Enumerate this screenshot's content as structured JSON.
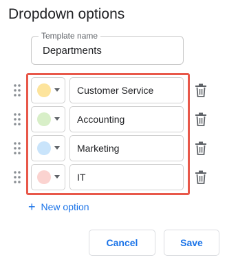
{
  "dialog": {
    "title": "Dropdown options"
  },
  "template": {
    "label": "Template name",
    "value": "Departments"
  },
  "options": [
    {
      "text": "Customer Service",
      "color": "#fde49c",
      "color_icon": "color-swatch",
      "delete_icon": "trash-icon",
      "drag_icon": "drag-handle-icon"
    },
    {
      "text": "Accounting",
      "color": "#d8efc8",
      "color_icon": "color-swatch",
      "delete_icon": "trash-icon",
      "drag_icon": "drag-handle-icon"
    },
    {
      "text": "Marketing",
      "color": "#c9e4fb",
      "color_icon": "color-swatch",
      "delete_icon": "trash-icon",
      "drag_icon": "drag-handle-icon"
    },
    {
      "text": "IT",
      "color": "#fbd3d0",
      "color_icon": "color-swatch",
      "delete_icon": "trash-icon",
      "drag_icon": "drag-handle-icon"
    }
  ],
  "add_option": {
    "icon": "+",
    "label": "New option"
  },
  "actions": {
    "cancel_label": "Cancel",
    "save_label": "Save"
  },
  "colors": {
    "accent": "#1a73e8",
    "highlight_border": "#e8584a"
  }
}
